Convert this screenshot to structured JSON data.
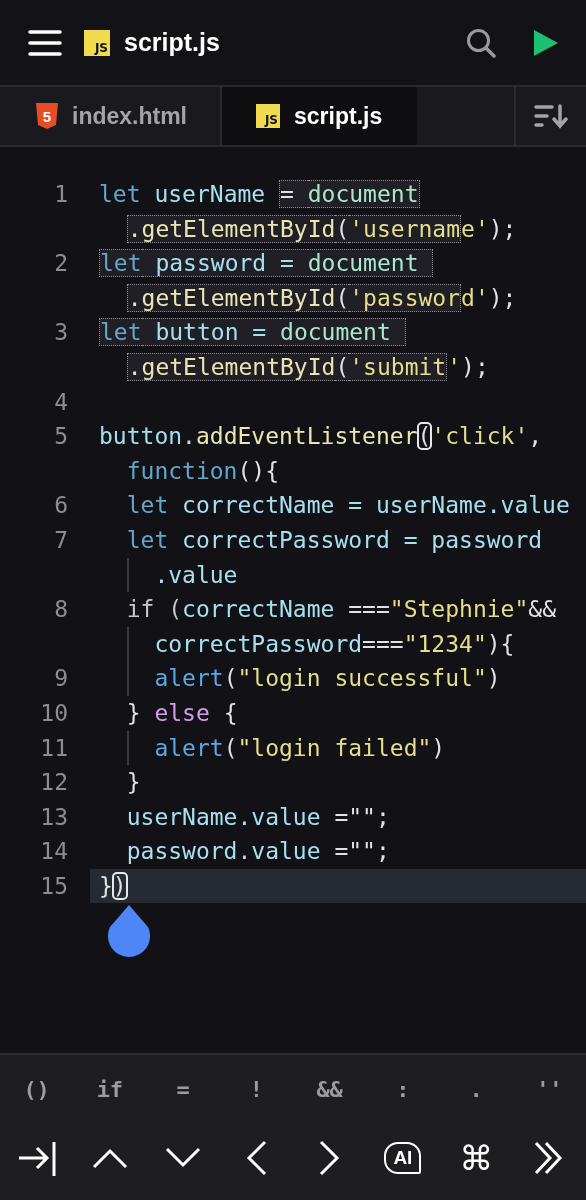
{
  "header": {
    "file_badge": "JS",
    "title": "script.js"
  },
  "tabs": [
    {
      "label": "index.html",
      "kind": "html",
      "badge": "5",
      "selected": false
    },
    {
      "label": "script.js",
      "kind": "js",
      "badge": "JS",
      "selected": true
    }
  ],
  "editor": {
    "rows": [
      {
        "number": "1",
        "wrapped": false,
        "guide": false,
        "current": false,
        "tokens": [
          {
            "t": "let",
            "color": "#62a8cb"
          },
          {
            "t": " userName ",
            "color": "#a6e0ef"
          },
          {
            "t": "= ",
            "color": "#e2e2e2",
            "boxed": true
          },
          {
            "t": "document",
            "color": "#a9e8cc",
            "boxed": true
          }
        ]
      },
      {
        "wrapped": true,
        "guide": false,
        "current": false,
        "tokens": [
          {
            "t": ".getElementById",
            "color": "#e9e6b4",
            "boxed": true
          },
          {
            "t": "(",
            "color": "#e2e2e2",
            "boxed": true
          },
          {
            "t": "'usernam",
            "color": "#e4df8a",
            "boxed": true
          },
          {
            "t": "e'",
            "color": "#e4df8a"
          },
          {
            "t": ");",
            "color": "#e2e2e2"
          }
        ]
      },
      {
        "number": "2",
        "wrapped": false,
        "guide": false,
        "current": false,
        "tokens": [
          {
            "t": "let",
            "color": "#62a8cb",
            "boxed": true
          },
          {
            "t": " password = ",
            "color": "#a6e0ef",
            "boxed": true
          },
          {
            "t": "document ",
            "color": "#a9e8cc",
            "boxed": true
          }
        ]
      },
      {
        "wrapped": true,
        "guide": false,
        "current": false,
        "tokens": [
          {
            "t": ".getElementById",
            "color": "#e9e6b4",
            "boxed": true
          },
          {
            "t": "(",
            "color": "#e2e2e2",
            "boxed": true
          },
          {
            "t": "'passwor",
            "color": "#e4df8a",
            "boxed": true
          },
          {
            "t": "d'",
            "color": "#e4df8a"
          },
          {
            "t": ");",
            "color": "#e2e2e2"
          }
        ]
      },
      {
        "number": "3",
        "wrapped": false,
        "guide": false,
        "current": false,
        "tokens": [
          {
            "t": "let",
            "color": "#62a8cb",
            "boxed": true
          },
          {
            "t": " button = ",
            "color": "#a6e0ef",
            "boxed": true
          },
          {
            "t": "document ",
            "color": "#a9e8cc",
            "boxed": true
          }
        ]
      },
      {
        "wrapped": true,
        "guide": false,
        "current": false,
        "tokens": [
          {
            "t": ".getElementById",
            "color": "#e9e6b4",
            "boxed": true
          },
          {
            "t": "(",
            "color": "#e2e2e2",
            "boxed": true
          },
          {
            "t": "'submit",
            "color": "#e4df8a",
            "boxed": true
          },
          {
            "t": "'",
            "color": "#e4df8a"
          },
          {
            "t": ");",
            "color": "#e2e2e2"
          }
        ]
      },
      {
        "number": "4"
      },
      {
        "number": "5",
        "wrapped": false,
        "guide": false,
        "current": false,
        "tokens": [
          {
            "t": "button.",
            "color": "#a6e0ef"
          },
          {
            "t": "addEventListener",
            "color": "#e9e6b4"
          },
          {
            "t": "(",
            "color": "#e2e2e2",
            "bracket": true
          },
          {
            "t": "'click'",
            "color": "#e4df8a"
          },
          {
            "t": ",",
            "color": "#e2e2e2"
          }
        ]
      },
      {
        "wrapped": true,
        "guide": false,
        "current": false,
        "tokens": [
          {
            "t": "function",
            "color": "#62a8cb"
          },
          {
            "t": "(){",
            "color": "#e2e2e2"
          }
        ]
      },
      {
        "number": "6",
        "wrapped": false,
        "guide": false,
        "current": false,
        "tokens": [
          {
            "t": "  let",
            "color": "#62a8cb"
          },
          {
            "t": " correctName = userName.value",
            "color": "#a6e0ef"
          }
        ]
      },
      {
        "number": "7",
        "wrapped": false,
        "guide": false,
        "current": false,
        "tokens": [
          {
            "t": "  let",
            "color": "#62a8cb"
          },
          {
            "t": " correctPassword = password",
            "color": "#a6e0ef"
          }
        ]
      },
      {
        "wrapped": true,
        "guide": true,
        "current": false,
        "tokens": [
          {
            "t": "  .value",
            "color": "#a6e0ef"
          }
        ]
      },
      {
        "number": "8",
        "wrapped": false,
        "guide": false,
        "current": false,
        "tokens": [
          {
            "t": "  if (",
            "color": "#c8c8c8"
          },
          {
            "t": "correctName",
            "color": "#a6e0ef"
          },
          {
            "t": " ===",
            "color": "#e2e2e2"
          },
          {
            "t": "\"Stephnie\"",
            "color": "#e4df8a"
          },
          {
            "t": "&&",
            "color": "#e2e2e2"
          }
        ]
      },
      {
        "wrapped": true,
        "guide": true,
        "current": false,
        "tokens": [
          {
            "t": "  correctPassword",
            "color": "#a6e0ef"
          },
          {
            "t": "===",
            "color": "#e2e2e2"
          },
          {
            "t": "\"1234\"",
            "color": "#e4df8a"
          },
          {
            "t": "){",
            "color": "#e2e2e2"
          }
        ]
      },
      {
        "number": "9",
        "wrapped": false,
        "guide": true,
        "current": false,
        "tokens": [
          {
            "t": "    alert",
            "color": "#5aa8e6"
          },
          {
            "t": "(",
            "color": "#e2e2e2"
          },
          {
            "t": "\"login successful\"",
            "color": "#e4df8a"
          },
          {
            "t": ")",
            "color": "#e2e2e2"
          }
        ]
      },
      {
        "number": "10",
        "wrapped": false,
        "guide": false,
        "current": false,
        "tokens": [
          {
            "t": "  } ",
            "color": "#e2e2e2"
          },
          {
            "t": "else",
            "color": "#d59de8"
          },
          {
            "t": " {",
            "color": "#e2e2e2"
          }
        ]
      },
      {
        "number": "11",
        "wrapped": false,
        "guide": true,
        "current": false,
        "tokens": [
          {
            "t": "    alert",
            "color": "#5aa8e6"
          },
          {
            "t": "(",
            "color": "#e2e2e2"
          },
          {
            "t": "\"login failed\"",
            "color": "#e4df8a"
          },
          {
            "t": ")",
            "color": "#e2e2e2"
          }
        ]
      },
      {
        "number": "12",
        "wrapped": false,
        "guide": false,
        "current": false,
        "tokens": [
          {
            "t": "  }",
            "color": "#e2e2e2"
          }
        ]
      },
      {
        "number": "13",
        "wrapped": false,
        "guide": false,
        "current": false,
        "tokens": [
          {
            "t": "  userName.value",
            "color": "#a6e0ef"
          },
          {
            "t": " =\"\";",
            "color": "#e2e2e2"
          }
        ]
      },
      {
        "number": "14",
        "wrapped": false,
        "guide": false,
        "current": false,
        "tokens": [
          {
            "t": "  password.value",
            "color": "#a6e0ef"
          },
          {
            "t": " =\"\";",
            "color": "#e2e2e2"
          }
        ]
      },
      {
        "number": "15",
        "wrapped": false,
        "guide": false,
        "current": true,
        "tokens": [
          {
            "t": "}",
            "color": "#e2e2e2"
          },
          {
            "t": ")",
            "color": "#e2e2e2",
            "bracket": true
          }
        ]
      }
    ]
  },
  "symbol_keys": [
    "()",
    "if",
    "=",
    "!",
    "&&",
    ":",
    ".",
    "''"
  ],
  "nav_keys": {
    "ai_label": "AI",
    "command": "⌘"
  }
}
